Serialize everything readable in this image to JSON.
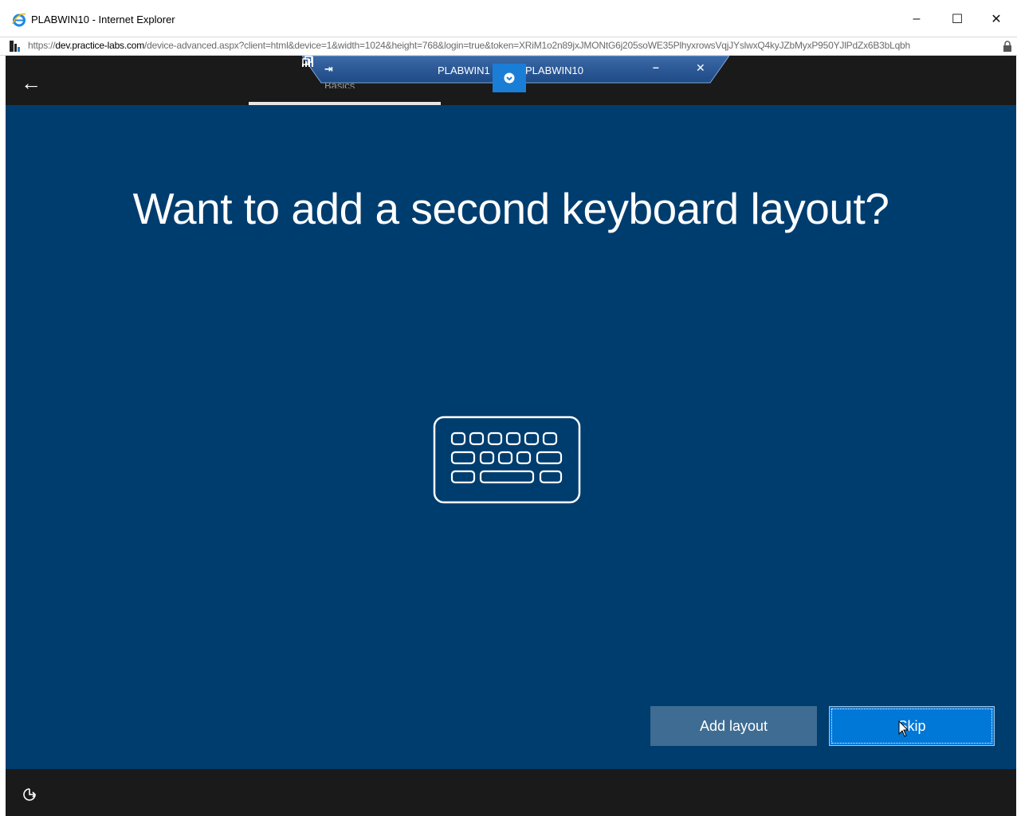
{
  "window": {
    "title": "PLABWIN10 - Internet Explorer",
    "minimize_glyph": "–",
    "maximize_glyph": "☐",
    "close_glyph": "✕"
  },
  "address": {
    "scheme": "https://",
    "host": "dev.practice-labs.com",
    "path": "/device-advanced.aspx?client=html&device=1&width=1024&height=768&login=true&token=XRiM1o2n89jxJMONtG6j205soWE35PlhyxrowsVqjJYslwxQ4kyJZbMyxP950YJlPdZx6B3bLqbh"
  },
  "rdp_bar": {
    "pin": "⇥",
    "title_left": "PLABWIN1",
    "title_right": "PLABWIN10",
    "minimize": "–",
    "close": "✕"
  },
  "oobe": {
    "back": "←",
    "tab_label": "Basics",
    "headline": "Want to add a second keyboard layout?",
    "icon": "keyboard-icon",
    "add_layout_label": "Add layout",
    "skip_label": "Skip"
  },
  "colors": {
    "oobe_background": "#003d6f",
    "primary_button": "#0078d7",
    "secondary_button": "#3f6c92",
    "chrome_dark": "#1a1a1a"
  }
}
